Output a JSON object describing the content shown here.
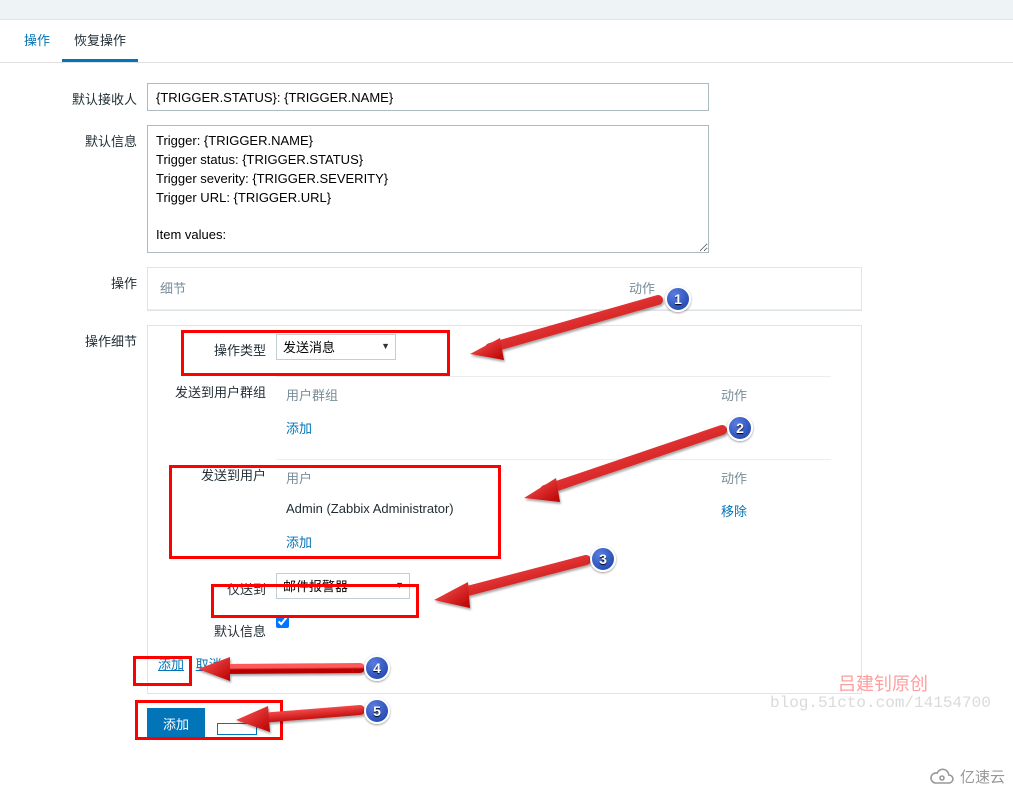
{
  "tabs": {
    "main": "操作",
    "recovery": "恢复操作"
  },
  "labels": {
    "default_recipient": "默认接收人",
    "default_message": "默认信息",
    "operations": "操作",
    "op_details": "操作细节",
    "op_type": "操作类型",
    "send_to_groups": "发送到用户群组",
    "send_to_users": "发送到用户",
    "only_to": "仅送到",
    "default_info_chk": "默认信息"
  },
  "fields": {
    "default_recipient_value": "{TRIGGER.STATUS}: {TRIGGER.NAME}",
    "default_message_value": "Trigger: {TRIGGER.NAME}\nTrigger status: {TRIGGER.STATUS}\nTrigger severity: {TRIGGER.SEVERITY}\nTrigger URL: {TRIGGER.URL}\n\nItem values:\n"
  },
  "ops_table": {
    "col_detail": "细节",
    "col_action": "动作"
  },
  "op_type_select": "发送消息",
  "groups": {
    "col_group": "用户群组",
    "col_action": "动作",
    "add": "添加"
  },
  "users": {
    "col_user": "用户",
    "col_action": "动作",
    "row_user": "Admin (Zabbix Administrator)",
    "row_action": "移除",
    "add": "添加"
  },
  "only_to_select": "邮件报警器",
  "inline": {
    "add": "添加",
    "cancel": "取消"
  },
  "buttons": {
    "add_primary": "添加"
  },
  "watermark": {
    "author": "吕建钊原创",
    "url": "blog.51cto.com/14154700"
  },
  "logo_text": "亿速云",
  "badges": {
    "b1": "1",
    "b2": "2",
    "b3": "3",
    "b4": "4",
    "b5": "5"
  }
}
